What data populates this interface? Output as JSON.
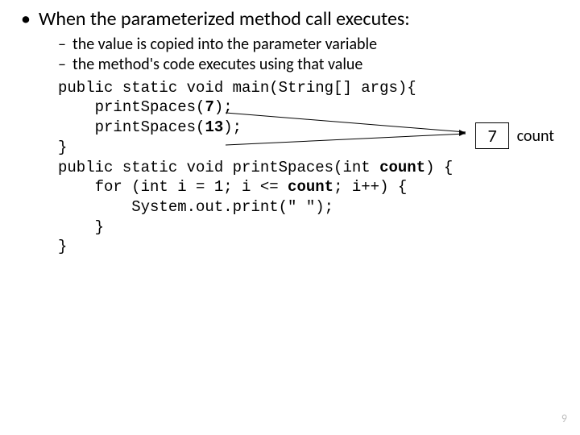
{
  "bullet": "When the parameterized method call executes:",
  "subs": [
    "the value is copied into the parameter variable",
    "the method's code executes using that value"
  ],
  "code": {
    "l1a": "public static void main(String[] args){",
    "l2a": "    printSpaces(",
    "l2b": "7",
    "l2c": ");",
    "l3a": "    printSpaces(",
    "l3b": "13",
    "l3c": ");",
    "l4a": "}",
    "l5a": "public static void printSpaces(int ",
    "l5b": "count",
    "l5c": ") {",
    "l6a": "    for (int i = 1; i <= ",
    "l6b": "count",
    "l6c": "; i++) {",
    "l7a": "        System.out.print(\" \");",
    "l8a": "    }",
    "l9a": "}"
  },
  "annotation": {
    "value": "7",
    "label": "count"
  },
  "page": "9"
}
